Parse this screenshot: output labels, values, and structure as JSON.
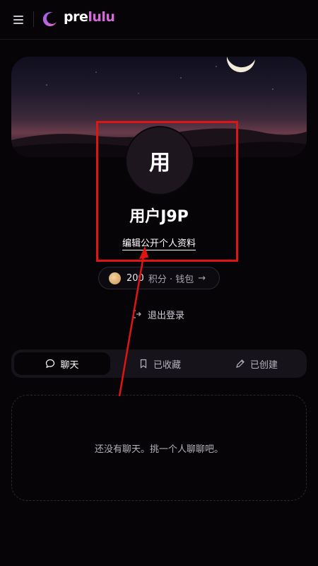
{
  "header": {
    "logo_pre": "pre",
    "logo_lulu": "lulu",
    "menu_icon": "hamburger-menu-icon",
    "logo_icon": "moon-logo-icon"
  },
  "profile": {
    "avatar_text": "用",
    "username": "用户J9P",
    "edit_link": "编辑公开个人资料"
  },
  "points": {
    "value": "200",
    "label": "积分 · 钱包",
    "arrow": "→",
    "icon": "coin-icon"
  },
  "logout": {
    "label": "退出登录",
    "icon": "logout-icon"
  },
  "tabs": [
    {
      "label": "聊天",
      "icon": "chat-bubble-icon",
      "active": true
    },
    {
      "label": "已收藏",
      "icon": "bookmark-icon",
      "active": false
    },
    {
      "label": "已创建",
      "icon": "pen-icon",
      "active": false
    }
  ],
  "empty_state": {
    "message": "还没有聊天。挑一个人聊聊吧。"
  },
  "colors": {
    "accent": "#d26bd6",
    "annotation": "#e11414",
    "background": "#060407"
  }
}
